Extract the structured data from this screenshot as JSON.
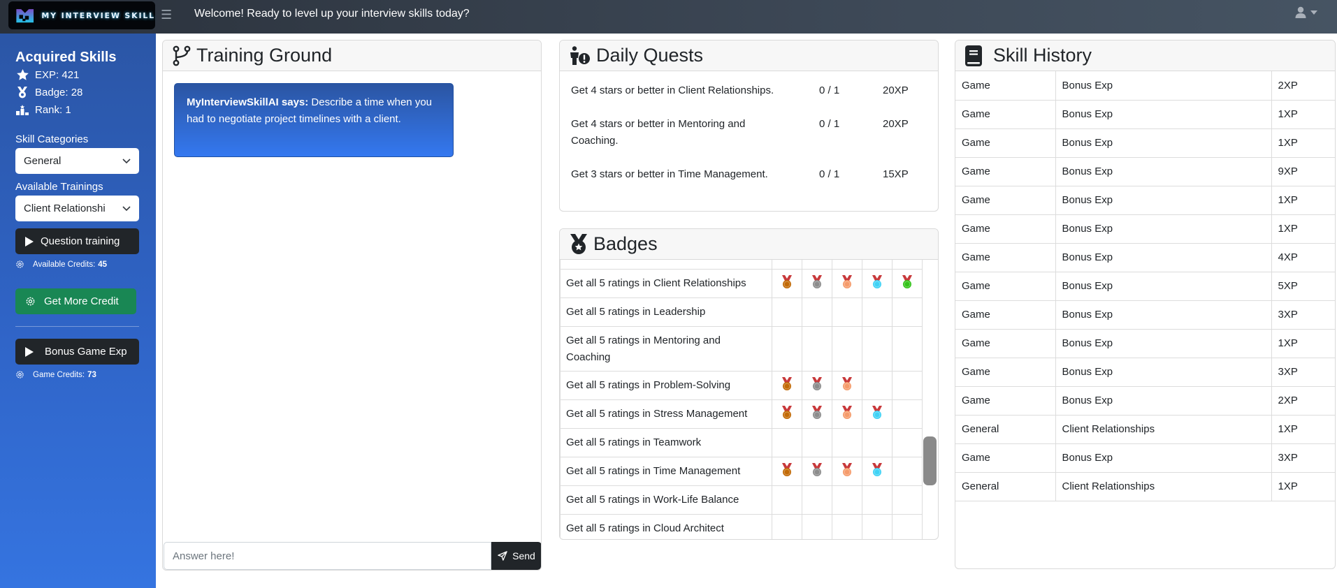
{
  "topbar": {
    "logo_text": "MY INTERVIEW SKILL",
    "welcome": "Welcome! Ready to level up your interview skills today?",
    "menu_icon": "hamburger-icon",
    "user_icon": "user-icon"
  },
  "sidebar": {
    "title": "Acquired Skills",
    "stats": {
      "exp": "EXP: 421",
      "badge": "Badge: 28",
      "rank": "Rank: 1"
    },
    "skill_categories_label": "Skill Categories",
    "skill_category_value": "General",
    "available_trainings_label": "Available Trainings",
    "available_training_value": "Client Relationshi",
    "question_training_label": "Question training",
    "available_credits_label": "Available Credits:",
    "available_credits_value": "45",
    "get_more_credit_label": "Get More Credit",
    "bonus_game_label": "Bonus Game Exp",
    "game_credits_label": "Game Credits:",
    "game_credits_value": "73"
  },
  "training": {
    "title": "Training Ground",
    "ai_speaker": "MyInterviewSkillAI says:",
    "ai_message": "Describe a time when you had to negotiate project timelines with a client.",
    "answer_placeholder": "Answer here!",
    "send_label": "Send"
  },
  "quests": {
    "title": "Daily Quests",
    "items": [
      {
        "text": "Get 4 stars or better in Client Relationships.",
        "progress": "0 / 1",
        "xp": "20XP"
      },
      {
        "text": "Get 4 stars or better in Mentoring and Coaching.",
        "progress": "0 / 1",
        "xp": "20XP"
      },
      {
        "text": "Get 3 stars or better in Time Management.",
        "progress": "0 / 1",
        "xp": "15XP"
      }
    ]
  },
  "badges": {
    "title": "Badges",
    "medal_colors": [
      "#c26a06",
      "#8c8c8c",
      "#f59b6b",
      "#3fd2f5",
      "#34c41a"
    ],
    "rows": [
      {
        "name": "Get all 5 ratings in Client Relationships",
        "earned": 5
      },
      {
        "name": "Get all 5 ratings in Leadership",
        "earned": 0
      },
      {
        "name": "Get all 5 ratings in Mentoring and Coaching",
        "earned": 0
      },
      {
        "name": "Get all 5 ratings in Problem-Solving",
        "earned": 3
      },
      {
        "name": "Get all 5 ratings in Stress Management",
        "earned": 4
      },
      {
        "name": "Get all 5 ratings in Teamwork",
        "earned": 0
      },
      {
        "name": "Get all 5 ratings in Time Management",
        "earned": 4
      },
      {
        "name": "Get all 5 ratings in Work-Life Balance",
        "earned": 0
      },
      {
        "name": "Get all 5 ratings in Cloud Architect",
        "earned": 0
      }
    ]
  },
  "history": {
    "title": "Skill History",
    "rows": [
      [
        "Game",
        "Bonus Exp",
        "2XP"
      ],
      [
        "Game",
        "Bonus Exp",
        "1XP"
      ],
      [
        "Game",
        "Bonus Exp",
        "1XP"
      ],
      [
        "Game",
        "Bonus Exp",
        "9XP"
      ],
      [
        "Game",
        "Bonus Exp",
        "1XP"
      ],
      [
        "Game",
        "Bonus Exp",
        "1XP"
      ],
      [
        "Game",
        "Bonus Exp",
        "4XP"
      ],
      [
        "Game",
        "Bonus Exp",
        "5XP"
      ],
      [
        "Game",
        "Bonus Exp",
        "3XP"
      ],
      [
        "Game",
        "Bonus Exp",
        "1XP"
      ],
      [
        "Game",
        "Bonus Exp",
        "3XP"
      ],
      [
        "Game",
        "Bonus Exp",
        "2XP"
      ],
      [
        "General",
        "Client Relationships",
        "1XP"
      ],
      [
        "Game",
        "Bonus Exp",
        "3XP"
      ],
      [
        "General",
        "Client Relationships",
        "1XP"
      ]
    ]
  }
}
